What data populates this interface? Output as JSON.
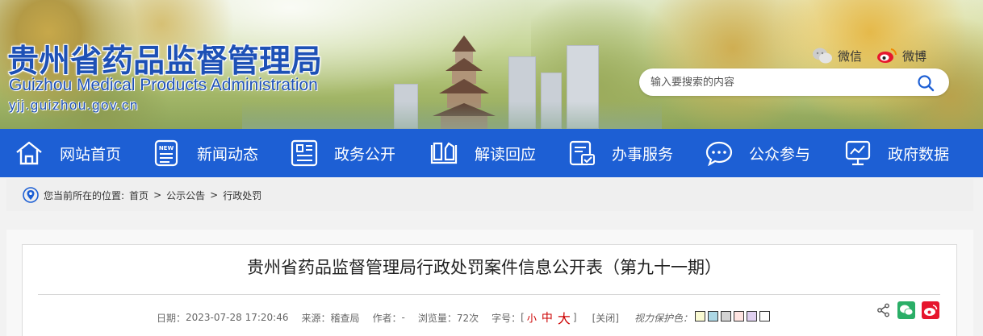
{
  "header": {
    "title_cn": "贵州省药品监督管理局",
    "title_en": "Guizhou Medical Products Administration",
    "url": "yjj.guizhou.gov.cn",
    "social": {
      "wechat_label": "微信",
      "weibo_label": "微博"
    },
    "search": {
      "placeholder": "输入要搜索的内容"
    }
  },
  "nav": {
    "items": [
      {
        "label": "网站首页",
        "icon": "home-icon"
      },
      {
        "label": "新闻动态",
        "icon": "news-icon"
      },
      {
        "label": "政务公开",
        "icon": "document-icon"
      },
      {
        "label": "解读回应",
        "icon": "book-icon"
      },
      {
        "label": "办事服务",
        "icon": "service-icon"
      },
      {
        "label": "公众参与",
        "icon": "chat-icon"
      },
      {
        "label": "政府数据",
        "icon": "data-icon"
      }
    ]
  },
  "breadcrumb": {
    "prefix": "您当前所在的位置:",
    "items": [
      "首页",
      "公示公告",
      "行政处罚"
    ],
    "separator": ">"
  },
  "article": {
    "title": "贵州省药品监督管理局行政处罚案件信息公开表（第九十一期）",
    "meta": {
      "date_label": "日期：",
      "date_value": "2023-07-28 17:20:46",
      "source_label": "来源：",
      "source_value": "稽查局",
      "author_label": "作者：",
      "author_value": "-",
      "views_label": "浏览量：",
      "views_value": "72次",
      "fontsize_label": "字号：",
      "bracket_open": "[",
      "bracket_close": "]",
      "size_small": "小",
      "size_medium": "中",
      "size_large": "大",
      "close_label": "[关闭]",
      "eyecare_label": "视力保护色："
    },
    "swatch_colors": [
      "#fafad2",
      "#add8e6",
      "#d3d3d3",
      "#ffe4e1",
      "#e0d0f0",
      "#ffffff"
    ]
  },
  "colors": {
    "brand_blue": "#1d5fd4",
    "logo_blue": "#1e51b6",
    "wechat_green": "#2aae67",
    "weibo_red": "#e6162d"
  }
}
